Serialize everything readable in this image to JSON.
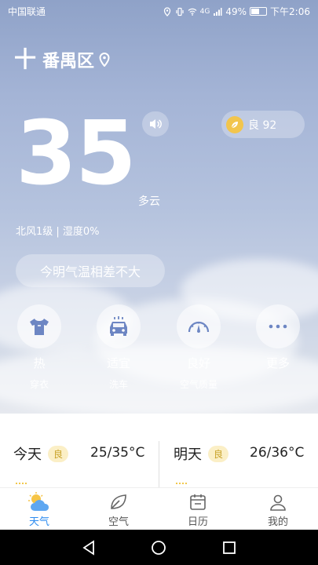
{
  "status_bar": {
    "carrier": "中国联通",
    "signal_label": "4G",
    "battery": "49%",
    "time": "下午2:06"
  },
  "location": {
    "add_symbol": "十",
    "name": "番禺区"
  },
  "weather": {
    "temperature": "35",
    "condition": "多云",
    "wind_humidity": "北风1级 | 湿度0%",
    "tip": "今明气温相差不大"
  },
  "aqi": {
    "label": "良 92"
  },
  "quick_actions": [
    {
      "value": "热",
      "label": "穿衣",
      "icon": "shirt-icon"
    },
    {
      "value": "适宜",
      "label": "洗车",
      "icon": "car-icon"
    },
    {
      "value": "良好",
      "label": "空气质量",
      "icon": "gauge-icon"
    },
    {
      "value": "更多",
      "label": "",
      "icon": "more-icon"
    }
  ],
  "forecast": {
    "today": {
      "name": "今天",
      "quality": "良",
      "range": "25/35°C"
    },
    "tomorrow": {
      "name": "明天",
      "quality": "良",
      "range": "26/36°C"
    }
  },
  "tabs": [
    {
      "label": "天气",
      "active": true
    },
    {
      "label": "空气",
      "active": false
    },
    {
      "label": "日历",
      "active": false
    },
    {
      "label": "我的",
      "active": false
    }
  ],
  "colors": {
    "accent": "#2d8cf0",
    "aqi_badge": "#f2c54d"
  }
}
